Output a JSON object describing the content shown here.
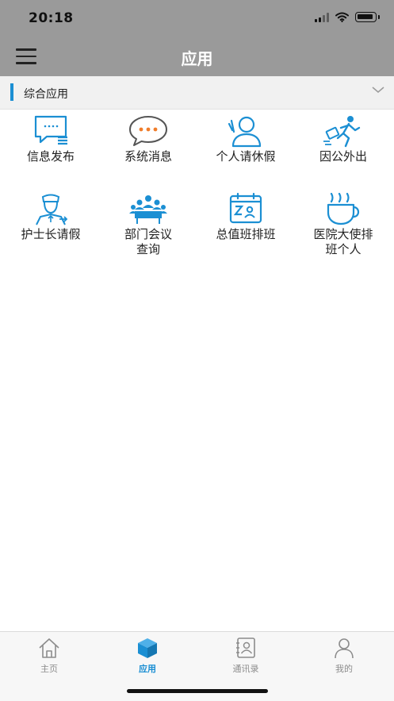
{
  "status_bar": {
    "time": "20:18"
  },
  "nav": {
    "title": "应用",
    "menu_icon": "hamburger-menu-icon"
  },
  "section": {
    "title": "综合应用",
    "accent": "#1b8fd3",
    "chevron_icon": "chevron-down-icon"
  },
  "apps": [
    {
      "label": "信息发布",
      "icon": "message-board-icon"
    },
    {
      "label": "系统消息",
      "icon": "chat-bubble-icon"
    },
    {
      "label": "个人请休假",
      "icon": "person-waving-icon"
    },
    {
      "label": "因公外出",
      "icon": "person-running-briefcase-icon"
    },
    {
      "label": "护士长请假",
      "icon": "nurse-icon"
    },
    {
      "label_line1": "部门会议",
      "label_line2": "查询",
      "icon": "meeting-icon"
    },
    {
      "label": "总值班排班",
      "icon": "calendar-schedule-icon"
    },
    {
      "label_line1": "医院大使排",
      "label_line2": "班个人",
      "icon": "coffee-cup-icon"
    }
  ],
  "tabs": [
    {
      "label": "主页",
      "icon": "home-icon",
      "active": false
    },
    {
      "label": "应用",
      "icon": "cube-icon",
      "active": true
    },
    {
      "label": "通讯录",
      "icon": "contacts-book-icon",
      "active": false
    },
    {
      "label": "我的",
      "icon": "user-icon",
      "active": false
    }
  ],
  "colors": {
    "accent": "#1b8fd3",
    "orange": "#f07c2a",
    "bar_gray": "#9a9a9a"
  }
}
